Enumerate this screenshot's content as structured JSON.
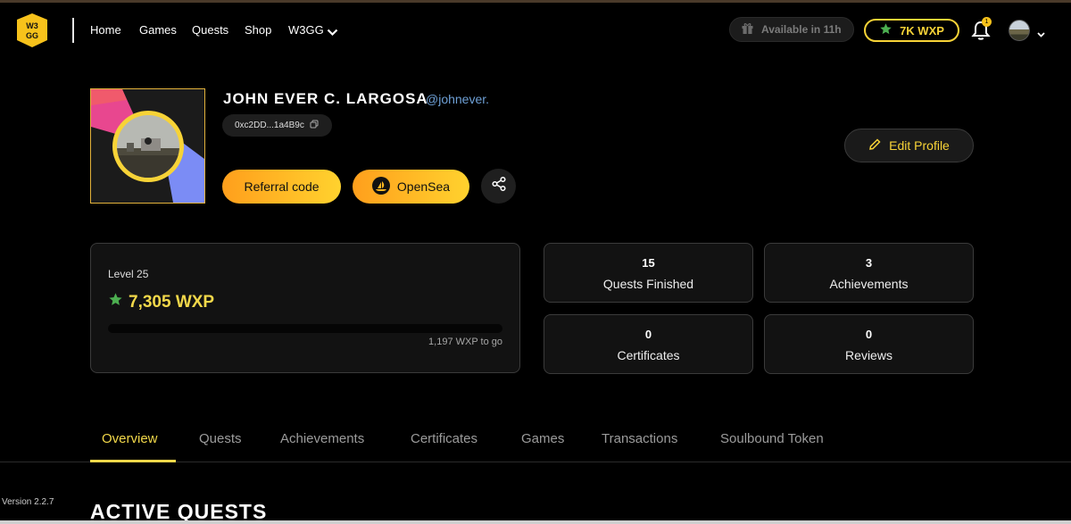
{
  "nav": {
    "logo_text": "W3GG",
    "items": [
      {
        "label": "Home"
      },
      {
        "label": "Games"
      },
      {
        "label": "Quests"
      },
      {
        "label": "Shop"
      },
      {
        "label": "W3GG"
      }
    ],
    "available_label": "Available in 11h",
    "wxp_label": "7K WXP",
    "notification_count": "1"
  },
  "profile": {
    "name": "JOHN EVER C. LARGOSA",
    "handle": "@johnever.",
    "wallet": "0xc2DD...1a4B9c",
    "referral_label": "Referral code",
    "opensea_label": "OpenSea",
    "edit_label": "Edit Profile"
  },
  "level": {
    "label": "Level 25",
    "wxp": "7,305 WXP",
    "progress_fraction": 0,
    "to_go": "1,197 WXP to go"
  },
  "stats": [
    {
      "value": "15",
      "label": "Quests Finished"
    },
    {
      "value": "3",
      "label": "Achievements"
    },
    {
      "value": "0",
      "label": "Certificates"
    },
    {
      "value": "0",
      "label": "Reviews"
    }
  ],
  "tabs": [
    {
      "label": "Overview"
    },
    {
      "label": "Quests"
    },
    {
      "label": "Achievements"
    },
    {
      "label": "Certificates"
    },
    {
      "label": "Games"
    },
    {
      "label": "Transactions"
    },
    {
      "label": "Soulbound Token"
    }
  ],
  "version": "Version 2.2.7",
  "section_title": "ACTIVE QUESTS",
  "colors": {
    "accent": "#f2d84a",
    "link": "#6ea0d6",
    "button_gradient_start": "#ff9f1c",
    "button_gradient_end": "#ffd22e"
  }
}
